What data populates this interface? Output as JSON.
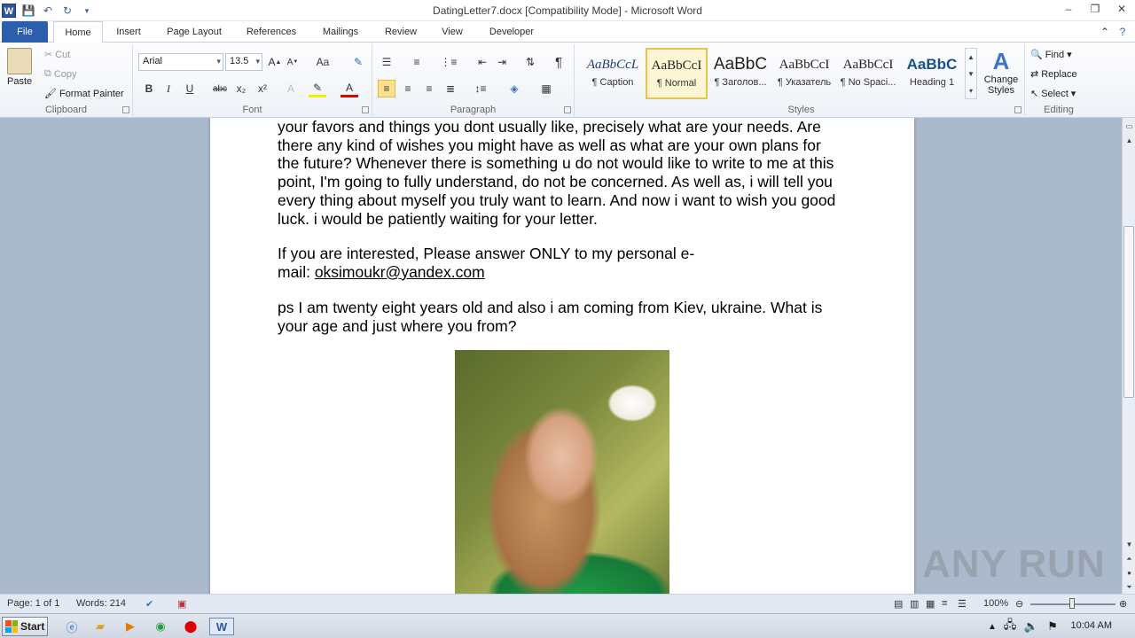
{
  "window": {
    "title": "DatingLetter7.docx [Compatibility Mode] - Microsoft Word",
    "app_icon": "W"
  },
  "tabs": [
    "File",
    "Home",
    "Insert",
    "Page Layout",
    "References",
    "Mailings",
    "Review",
    "View",
    "Developer"
  ],
  "clipboard": {
    "paste": "Paste",
    "cut": "Cut",
    "copy": "Copy",
    "format_painter": "Format Painter",
    "label": "Clipboard"
  },
  "font": {
    "family": "Arial",
    "size": "13.5",
    "label": "Font",
    "bold": "B",
    "italic": "I",
    "underline": "U",
    "strike": "abc",
    "sub": "x₂",
    "sup": "x²"
  },
  "paragraph": {
    "label": "Paragraph",
    "pilcrow": "¶"
  },
  "styles": {
    "label": "Styles",
    "items": [
      {
        "sample": "AaBbCcL",
        "name": "¶ Caption"
      },
      {
        "sample": "AaBbCcI",
        "name": "¶ Normal"
      },
      {
        "sample": "AaBbC",
        "name": "¶ Заголов..."
      },
      {
        "sample": "AaBbCcI",
        "name": "¶ Указатель"
      },
      {
        "sample": "AaBbCcI",
        "name": "¶ No Spaci..."
      },
      {
        "sample": "AaBbC",
        "name": "Heading 1"
      }
    ],
    "change_styles": "Change Styles"
  },
  "editing": {
    "label": "Editing",
    "find": "Find",
    "replace": "Replace",
    "select": "Select"
  },
  "document": {
    "p1": "your favors and things you dont usually like, precisely what are your needs. Are there any kind of wishes you might have as well as what are your own plans for the future? Whenever there is something u do not would like to write to me at this point, I'm  going to fully understand, do not be concerned. As well as, i will tell you every thing about myself you truly want to learn. And now i want to wish you good luck. i would be patiently waiting for your letter.",
    "p2_line1": "If you are interested, Please answer ONLY to my personal e-",
    "p2_prefix": "mail: ",
    "email": "oksimoukr@yandex.com",
    "p3": "ps I am twenty eight years old and also i am coming from Kiev, ukraine. What is your age and just where you from?"
  },
  "status": {
    "page": "Page: 1 of 1",
    "words": "Words: 214",
    "zoom": "100%"
  },
  "taskbar": {
    "start": "Start",
    "clock": "10:04 AM"
  },
  "watermark": "ANY RUN"
}
